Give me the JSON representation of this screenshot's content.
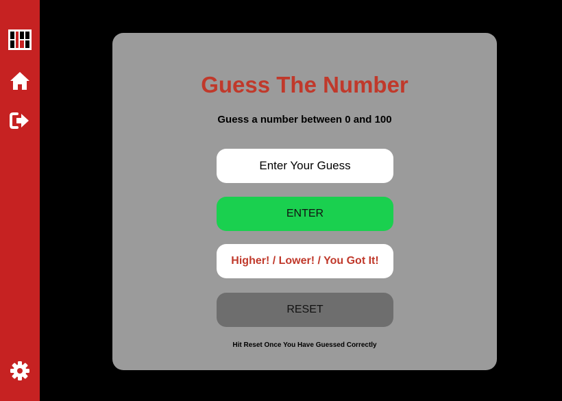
{
  "sidebar": {
    "background": "#c62222",
    "items": [
      {
        "icon": "app-logo-icon"
      },
      {
        "icon": "home-icon"
      },
      {
        "icon": "logout-icon"
      },
      {
        "icon": "gear-icon"
      }
    ]
  },
  "game": {
    "title": "Guess The Number",
    "subtitle": "Guess a number between 0 and 100",
    "input_placeholder": "Enter Your Guess",
    "input_value": "",
    "enter_label": "ENTER",
    "feedback_text": "Higher! / Lower! / You Got It!",
    "reset_label": "RESET",
    "hint_text": "Hit Reset Once You Have Guessed Correctly"
  },
  "colors": {
    "accent_red": "#c0392b",
    "enter_green": "#1ad04f",
    "reset_gray": "#6e6e6e",
    "card_gray": "#9b9b9b"
  }
}
